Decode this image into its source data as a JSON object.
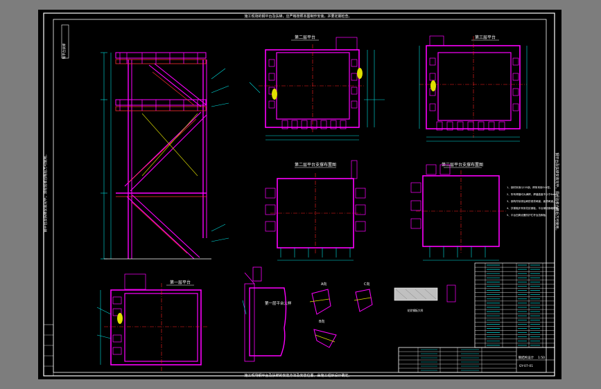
{
  "drawing": {
    "top_note": "施工现场的钢平台及扶梯，应严格按照本图制作安装，并要定期检查。",
    "bottom_note": "施工现场钢平台及扶梯的安装方法及安装位置，由施工组织设计确定。",
    "side_note": "钢平台及扶梯安装完毕，须经验收合格后方可使用。",
    "stamp_text": "钢平台扶梯",
    "views": {
      "platform_2": "第二层平台",
      "platform_3": "第三层平台",
      "platform_2_support": "第二层平台支撑布置图",
      "platform_3_support": "第三层平台支撑布置图",
      "platform_1": "第一层平台",
      "platform_1_detail": "第一层平台大样",
      "section_a": "A向",
      "section_b": "B向",
      "section_c": "C向"
    },
    "notes": [
      "1、钢材采用Q235钢，焊条采用E43型。",
      "2、所有焊缝均为满焊，焊缝高度不小于6mm。",
      "3、钢构件除锈后刷防锈漆两道，面漆两道。",
      "4、扶梯踏步采用花纹钢板，平台铺设钢格栅板。",
      "5、平台四周设置防护栏杆及挡脚板。"
    ],
    "rail_label": "花纹钢板大样",
    "title_block": {
      "company": "钢结构设计",
      "drawing_no": "GY-07-01",
      "scale": "1:50"
    },
    "colors": {
      "frame": "#ffffff",
      "steel": "#ff00ff",
      "member": "#ff3030",
      "center_line": "#ff2020",
      "dim": "#00e5e5",
      "detail": "#ffff00",
      "text": "#ffffff"
    }
  }
}
